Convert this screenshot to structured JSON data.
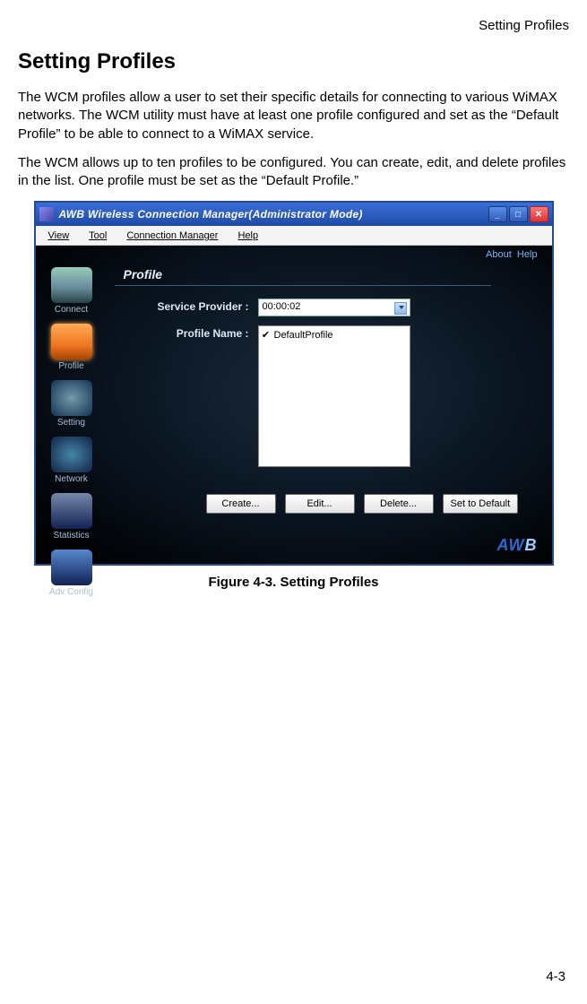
{
  "page": {
    "header_right": "Setting Profiles",
    "title": "Setting Profiles",
    "para1": "The WCM profiles allow a user to set their specific details for connecting to various WiMAX networks. The WCM utility must have at least one profile configured and set as the “Default Profile” to be able to connect to a WiMAX service.",
    "para2": "The WCM allows up to ten profiles to be configured. You can create, edit, and delete profiles in the list. One profile must be set as the “Default Profile.”",
    "figure_caption": "Figure 4-3.  Setting Profiles",
    "page_number": "4-3"
  },
  "window": {
    "title": "AWB Wireless Connection Manager(Administrator Mode)",
    "menus": {
      "view": "View",
      "tool": "Tool",
      "conn": "Connection Manager",
      "help": "Help"
    },
    "top_links": {
      "about": "About",
      "help": "Help"
    },
    "sidebar": {
      "connect": "Connect",
      "profile": "Profile",
      "setting": "Setting",
      "network": "Network",
      "statistics": "Statistics",
      "adv": "Adv Config"
    },
    "panel": {
      "title": "Profile",
      "sp_label": "Service Provider :",
      "sp_value": "00:00:02",
      "pn_label": "Profile Name :",
      "profiles": [
        "DefaultProfile"
      ],
      "buttons": {
        "create": "Create...",
        "edit": "Edit...",
        "delete": "Delete...",
        "setdefault": "Set to Default"
      }
    },
    "logo_a": "AW",
    "logo_b": "B"
  }
}
